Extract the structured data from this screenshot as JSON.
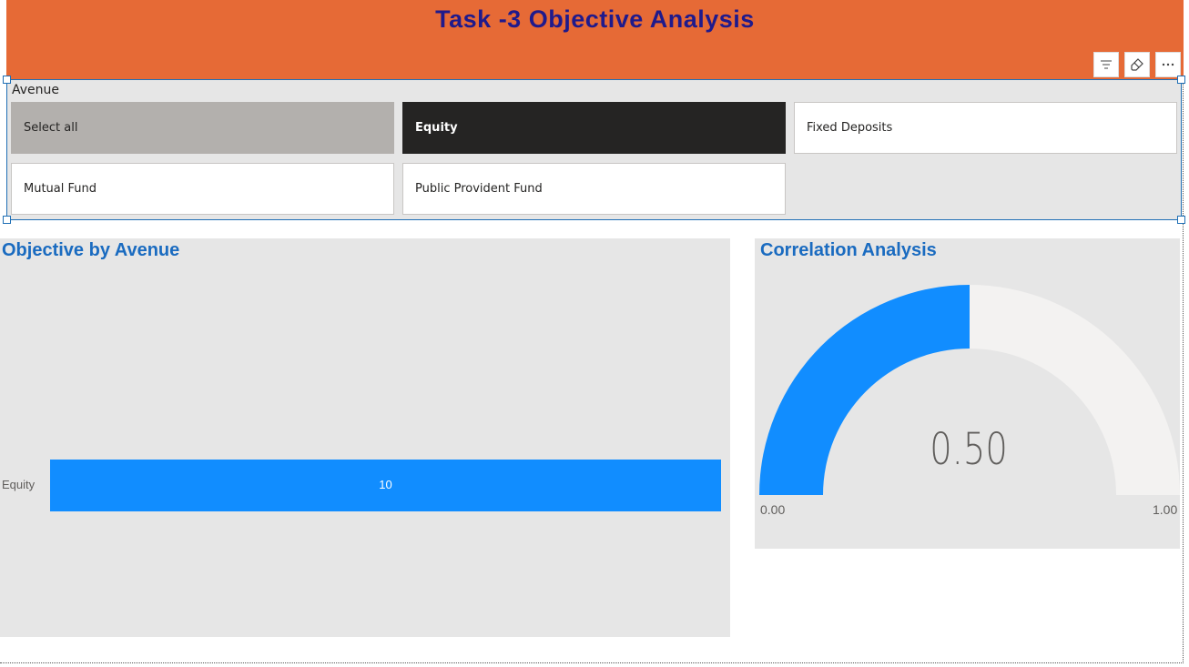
{
  "header": {
    "title": "Task -3 Objective Analysis"
  },
  "toolbar": {
    "icons": [
      "filter-icon",
      "eraser-icon",
      "more-options-icon"
    ]
  },
  "slicer": {
    "title": "Avenue",
    "items": [
      {
        "label": "Select all",
        "state": "partial"
      },
      {
        "label": "Equity",
        "state": "selected"
      },
      {
        "label": "Fixed Deposits",
        "state": "unselected"
      },
      {
        "label": "Mutual Fund",
        "state": "unselected"
      },
      {
        "label": "Public Provident Fund",
        "state": "unselected"
      }
    ]
  },
  "bar_panel": {
    "title": "Objective by Avenue"
  },
  "gauge_panel": {
    "title": "Correlation Analysis",
    "value_label": "0.50",
    "min_label": "0.00",
    "max_label": "1.00"
  },
  "colors": {
    "header_bg": "#e66a36",
    "title_text": "#1f1a8c",
    "accent_blue": "#118dff",
    "panel_title": "#1a6bc0",
    "gauge_track": "#f3f2f1"
  },
  "chart_data": [
    {
      "type": "bar",
      "orientation": "horizontal",
      "title": "Objective by Avenue",
      "categories": [
        "Equity"
      ],
      "values": [
        10
      ],
      "data_labels": [
        "10"
      ],
      "xlim": [
        0,
        10
      ]
    },
    {
      "type": "gauge",
      "title": "Correlation Analysis",
      "value": 0.5,
      "min": 0.0,
      "max": 1.0
    }
  ]
}
